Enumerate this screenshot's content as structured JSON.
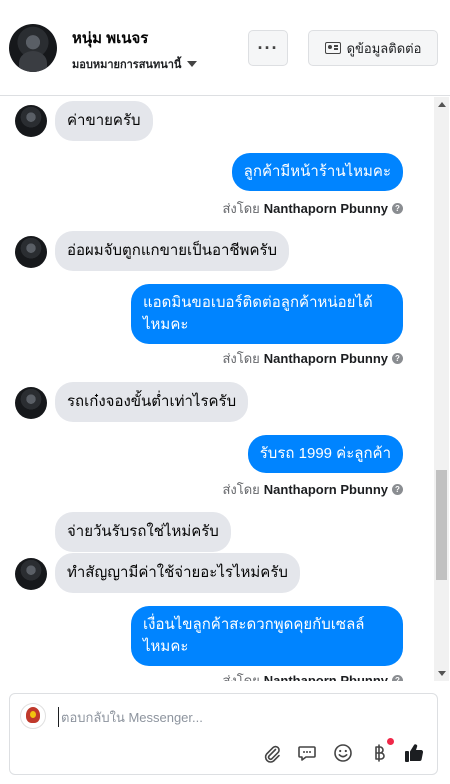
{
  "header": {
    "name": "หนุ่ม พเนจร",
    "assign_label": "มอบหมายการสนทนานี้",
    "more_label": "···",
    "contact_info_label": "ดูข้อมูลติดต่อ"
  },
  "messages": [
    {
      "from": "customer",
      "text": "ค่าขายครับ"
    },
    {
      "from": "page",
      "text": "ลูกค้ามีหน้าร้านไหมคะ",
      "sent_by_prefix": "ส่งโดย",
      "sent_by_name": "Nanthaporn Pbunny"
    },
    {
      "from": "customer",
      "text": "อ่อผมจับตูกแกขายเป็นอาชีพครับ"
    },
    {
      "from": "page",
      "text": "แอดมินขอเบอร์ติดต่อลูกค้าหน่อยได้ไหมคะ",
      "sent_by_prefix": "ส่งโดย",
      "sent_by_name": "Nanthaporn Pbunny"
    },
    {
      "from": "customer",
      "text": "รถเก๋งจองขั้นต่ำเท่าไรครับ"
    },
    {
      "from": "page",
      "text": "รับรถ 1999 ค่ะลูกค้า",
      "sent_by_prefix": "ส่งโดย",
      "sent_by_name": "Nanthaporn Pbunny"
    },
    {
      "from": "customer",
      "text": "จ่ายวันรับรถใช่ไหม่ครับ"
    },
    {
      "from": "customer",
      "text": "ทำสัญญามีค่าใช้จ่ายอะไรไหม่ครับ"
    },
    {
      "from": "page",
      "text": "เงื่อนไขลูกค้าสะดวกพูดคุยกับเซลล์ไหมคะ",
      "sent_by_prefix": "ส่งโดย",
      "sent_by_name": "Nanthaporn Pbunny"
    }
  ],
  "composer": {
    "placeholder": "ตอบกลับใน Messenger..."
  },
  "icons": {
    "attach": "paperclip-icon",
    "saved_replies": "chat-bubbles-icon",
    "emoji": "smiley-icon",
    "payment": "baht-icon",
    "like": "thumbs-up-icon"
  },
  "colors": {
    "outgoing_bubble": "#0084ff",
    "incoming_bubble": "#e4e6eb",
    "notification_dot": "#f02849"
  }
}
